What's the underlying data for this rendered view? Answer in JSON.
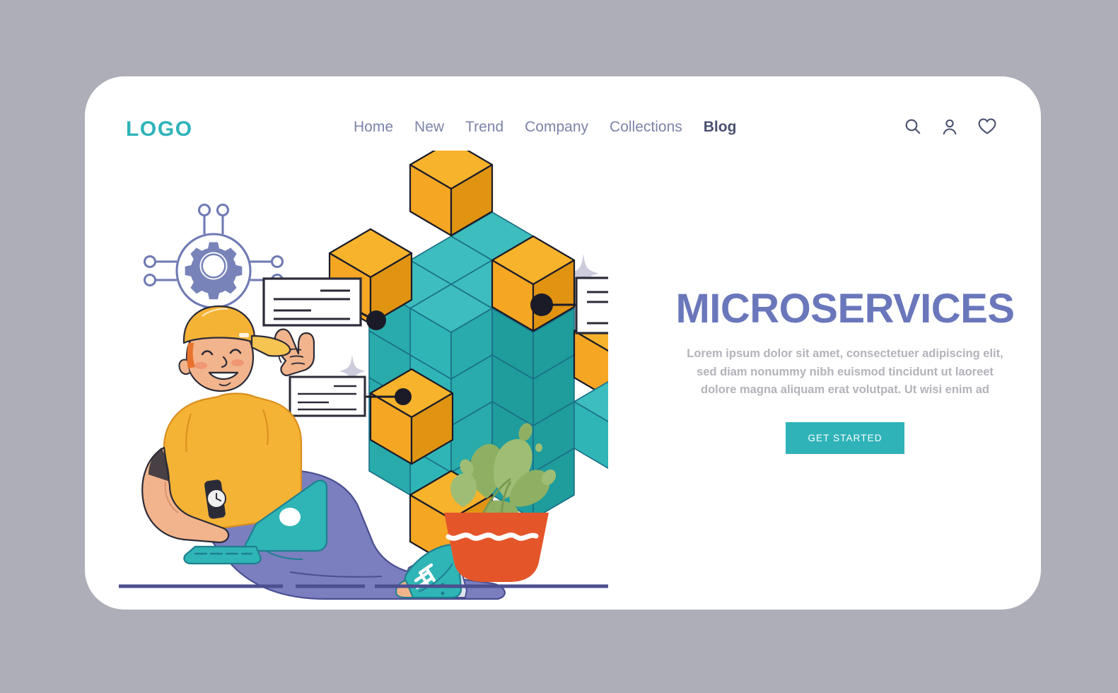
{
  "page": {
    "background_color": "#aeaeb8",
    "card_background": "#ffffff"
  },
  "header": {
    "logo": "LOGO",
    "nav": [
      {
        "label": "Home",
        "active": false
      },
      {
        "label": "New",
        "active": false
      },
      {
        "label": "Trend",
        "active": false
      },
      {
        "label": "Company",
        "active": false
      },
      {
        "label": "Collections",
        "active": false
      },
      {
        "label": "Blog",
        "active": true
      }
    ],
    "icons": [
      {
        "name": "search-icon",
        "glyph": "search"
      },
      {
        "name": "user-icon",
        "glyph": "user"
      },
      {
        "name": "favorite-icon",
        "glyph": "heart"
      }
    ]
  },
  "hero": {
    "title": "MICROSERVICES",
    "subtitle": "Lorem ipsum dolor sit amet, consectetuer adipiscing elit, sed diam nonummy nibh euismod tincidunt ut laoreet dolore magna aliquam erat volutpat. Ut wisi enim ad",
    "cta_label": "GET STARTED"
  },
  "illustration": {
    "name": "microservices-developer-illustration",
    "elements": [
      "gear-network-icon",
      "isometric-cube-cluster",
      "callout-card-left",
      "callout-card-right",
      "callout-card-bottom",
      "seated-developer-with-laptop",
      "potted-plant",
      "sparkle-decorations",
      "ground-lines"
    ]
  },
  "colors": {
    "brand_teal": "#2fb3b9",
    "cube_teal": "#28b3b3",
    "cube_orange": "#f5a623",
    "nav_text": "#7c83a8",
    "nav_active": "#4a5070",
    "heading_purple": "#6a77bb",
    "body_gray": "#b3b3bb",
    "pants_purple": "#7b7fc0",
    "shirt_yellow": "#f5b335",
    "skin": "#f0b08a",
    "pot_red": "#e4552a",
    "plant_green": "#8fb86a",
    "outline_dark": "#2b2b38"
  }
}
